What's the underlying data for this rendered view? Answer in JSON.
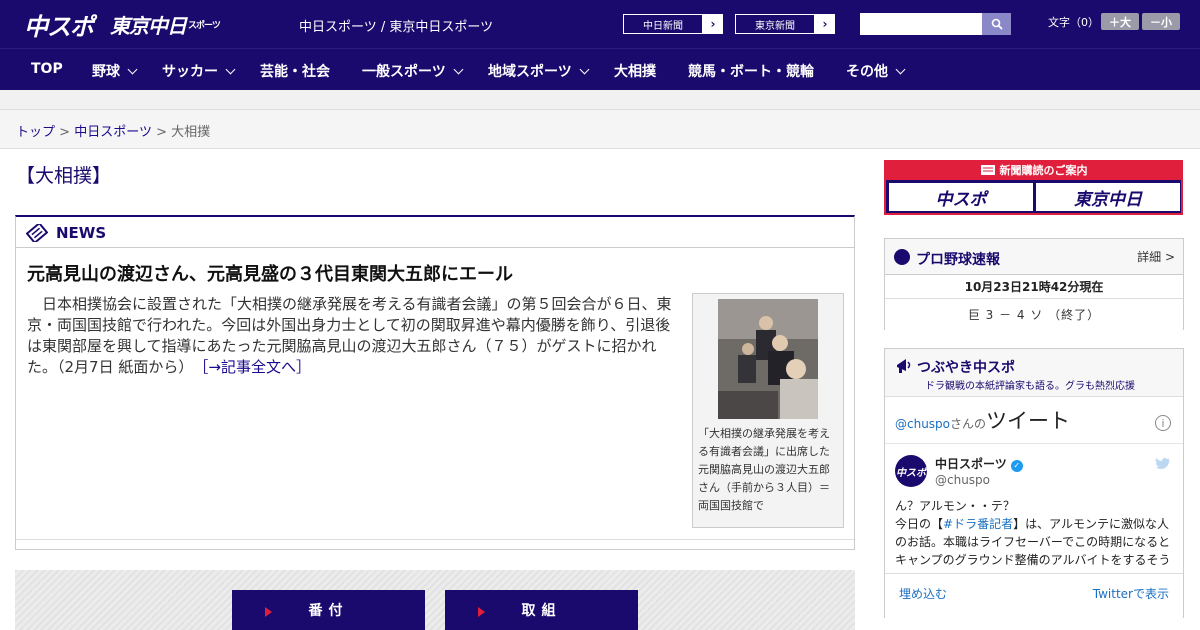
{
  "header": {
    "logo_main": "中スポ",
    "logo_tokyo": "東京中日",
    "logo_tokyo_small": "スポーツ",
    "site_names": "中日スポーツ / 東京中日スポーツ",
    "paper_links": [
      {
        "label": "中日新聞",
        "arrow": "›"
      },
      {
        "label": "東京新聞",
        "arrow": "›"
      }
    ],
    "search": {
      "placeholder": "",
      "icon": "search-icon"
    },
    "font_size_label": "文字（0）",
    "font_bigger": "＋大",
    "font_smaller": "－小"
  },
  "nav": {
    "items": [
      {
        "label": "TOP",
        "has_dropdown": false
      },
      {
        "label": "野球",
        "has_dropdown": true
      },
      {
        "label": "サッカー",
        "has_dropdown": true
      },
      {
        "label": "芸能・社会",
        "has_dropdown": false
      },
      {
        "label": "一般スポーツ",
        "has_dropdown": true
      },
      {
        "label": "地域スポーツ",
        "has_dropdown": true
      },
      {
        "label": "大相撲",
        "has_dropdown": false
      },
      {
        "label": "競馬・ボート・競輪",
        "has_dropdown": false
      },
      {
        "label": "その他",
        "has_dropdown": true
      }
    ]
  },
  "breadcrumb": {
    "items": [
      "トップ",
      "中日スポーツ",
      "大相撲"
    ],
    "separator": ">"
  },
  "page": {
    "title": "【大相撲】"
  },
  "news": {
    "section_label": "NEWS",
    "headline": "元高見山の渡辺さん、元高見盛の３代目東関大五郎にエール",
    "body": "　日本相撲協会に設置された「大相撲の継承発展を考える有識者会議」の第５回会合が６日、東京・両国国技館で行われた。今回は外国出身力士として初の関取昇進や幕内優勝を飾り、引退後は東関部屋を興して指導にあたった元関脇高見山の渡辺大五郎さん（７５）がゲストに招かれた。（2月7日 紙面から）",
    "more_link": "［→記事全文へ］",
    "photo_caption": "「大相撲の継承発展を考える有識者会議」に出席した元関脇高見山の渡辺大五郎さん（手前から３人目）＝両国国技館で"
  },
  "bottom_buttons": [
    {
      "label": "番付"
    },
    {
      "label": "取組"
    }
  ],
  "sidebar": {
    "subscribe": {
      "head": "新聞購読のご案内",
      "logos": [
        "中スポ",
        "東京中日"
      ]
    },
    "baseball": {
      "title": "プロ野球速報",
      "more": "詳細 >",
      "timestamp": "10月23日21時42分現在",
      "score": "巨 3 － 4 ソ （終了）"
    },
    "tweets": {
      "title": "つぶやき中スポ",
      "subtitle": "ドラ観戦の本紙評論家も語る。グラも熱烈応援",
      "handle_link": "@chuspo",
      "handle_suffix": "さんの",
      "heading": "ツイート",
      "user_name": "中日スポーツ",
      "user_handle": "@chuspo",
      "avatar_text": "中スポ",
      "text_line1": "ん？アルモン・・テ？",
      "text_pre": "今日の【",
      "hashtag": "#ドラ番記者",
      "text_post": "】は、アルモンテに激似な人のお話。本職はライフセーバーでこの時期になるとキャンプのグラウンド整備のアルバイトをするそう",
      "embed": "埋め込む",
      "view_on": "Twitterで表示"
    }
  },
  "colors": {
    "brand_navy": "#1a0a6e",
    "accent_red": "#e01f3d",
    "link_blue": "#1b6fc1"
  }
}
